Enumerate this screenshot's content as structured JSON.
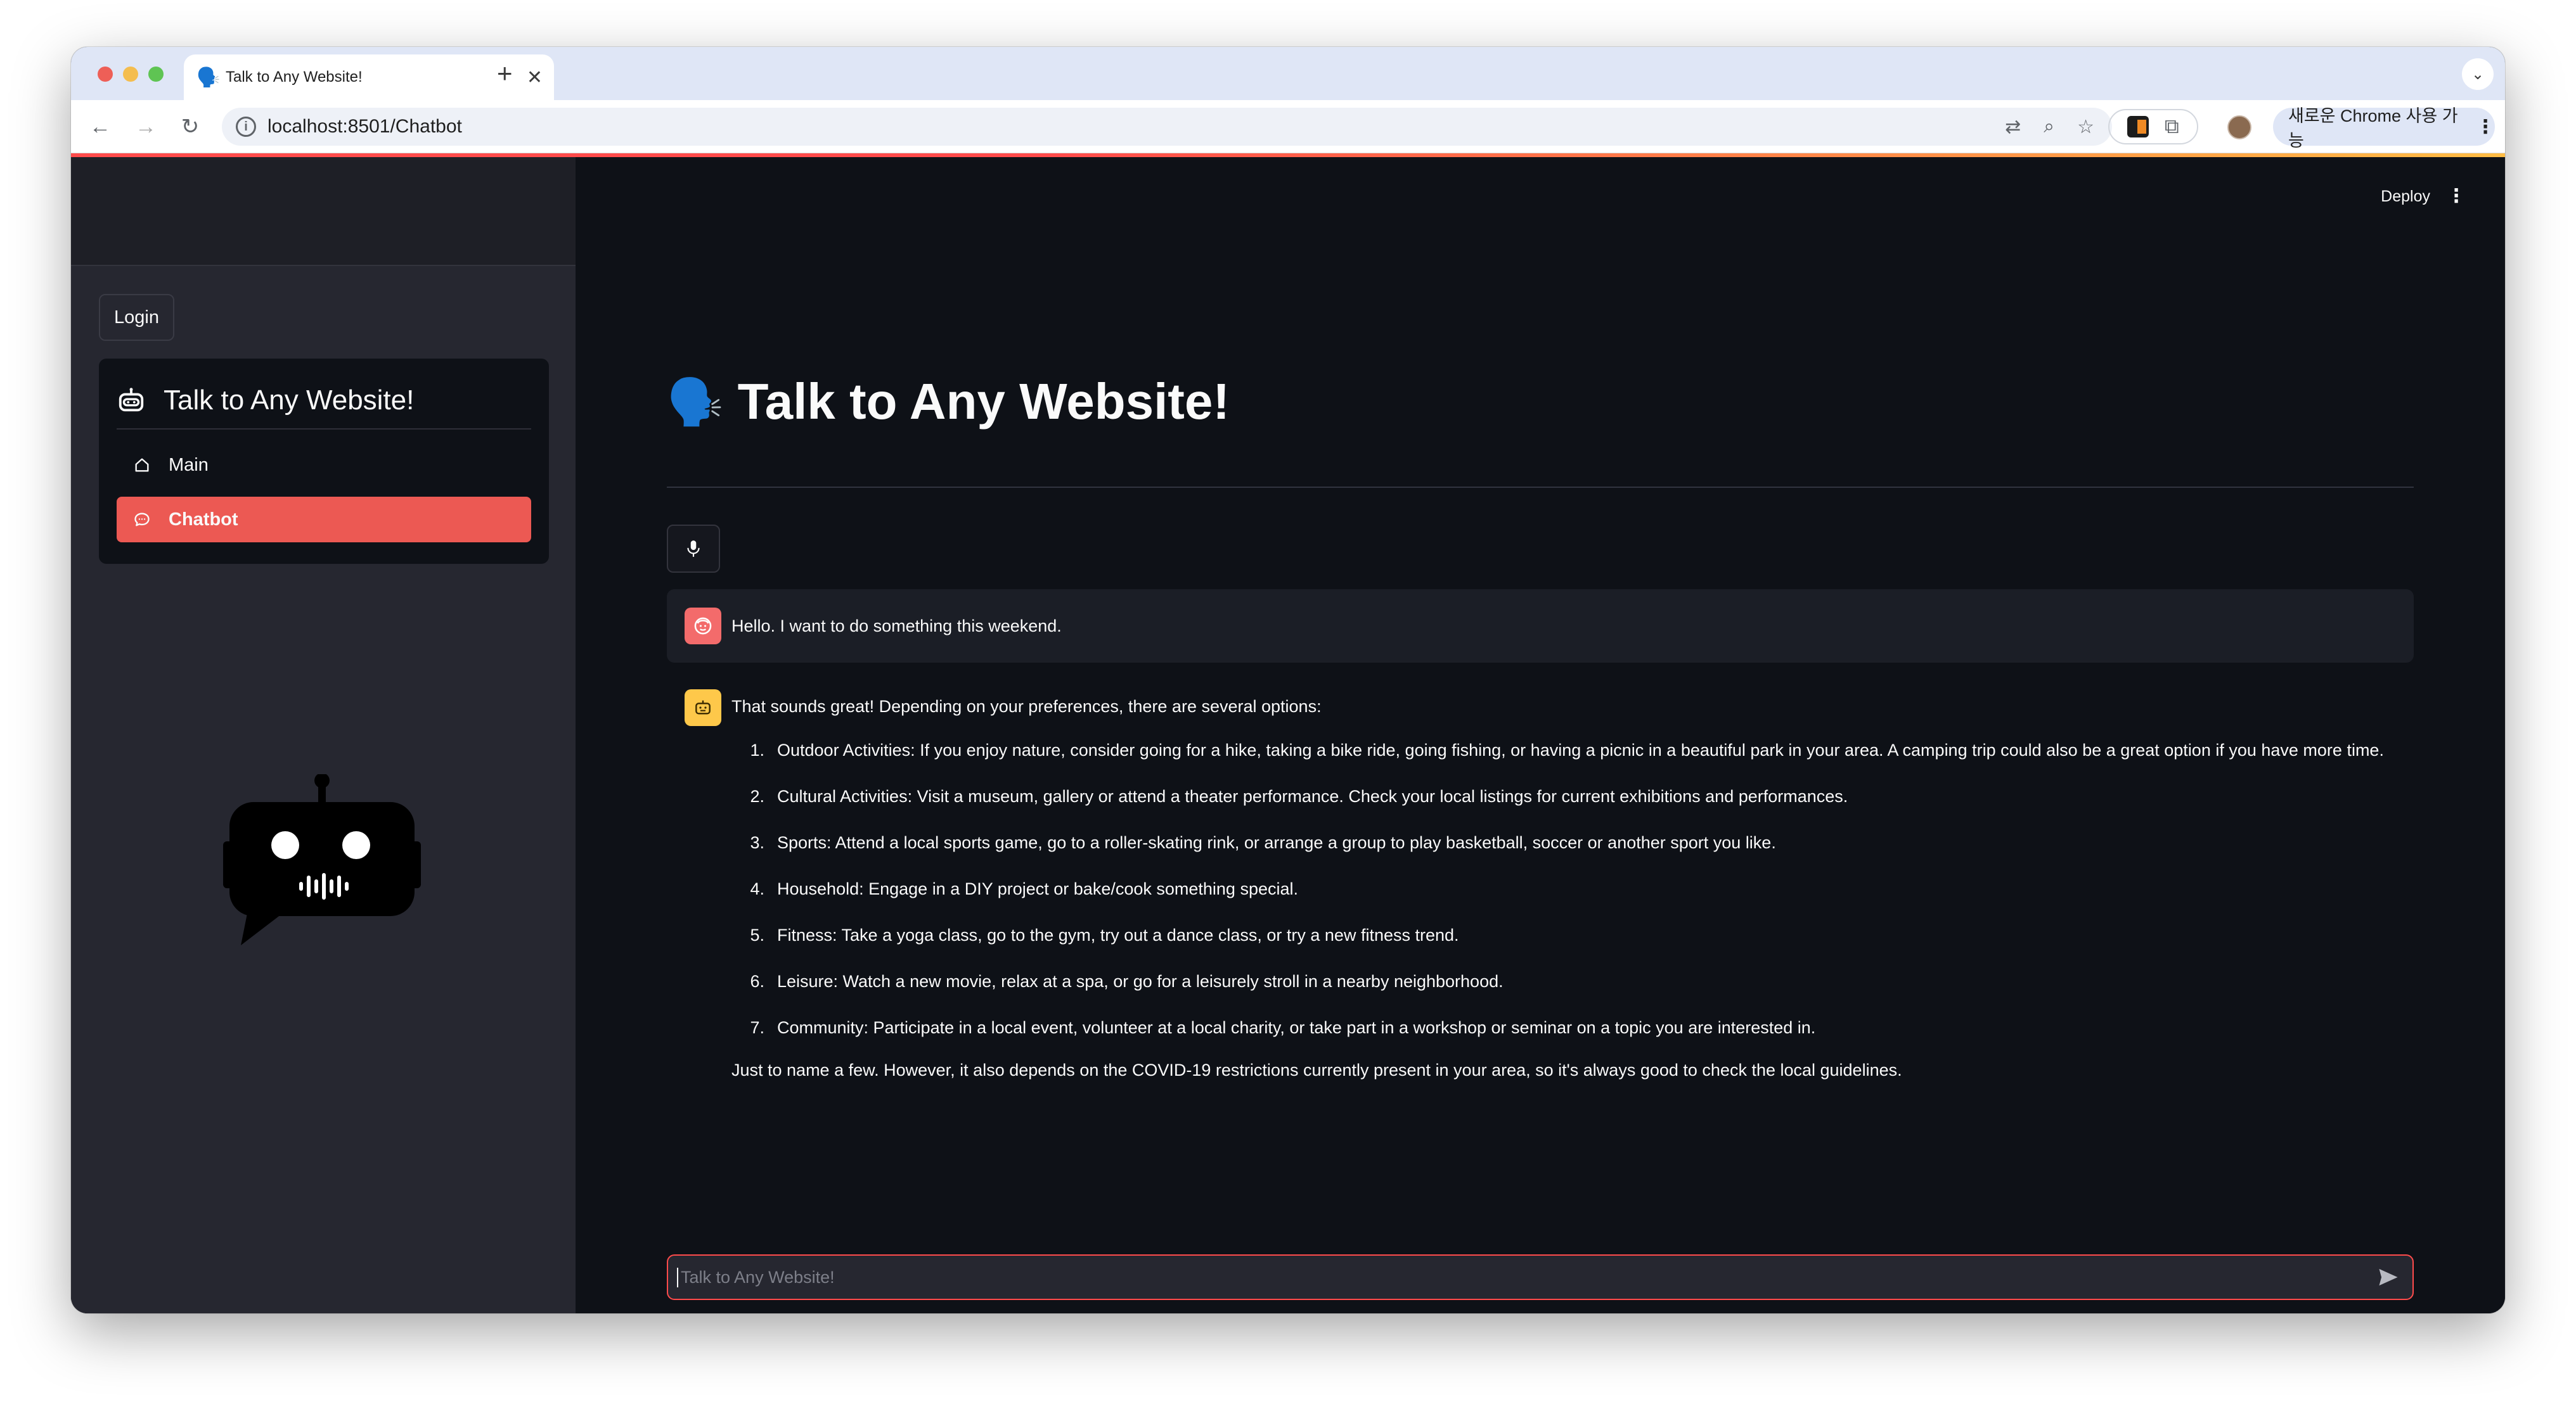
{
  "browser": {
    "tab_title": "Talk to Any Website!",
    "tab_favicon": "🗣️",
    "new_tab_label": "+",
    "url": "localhost:8501/Chatbot",
    "chrome_button_label": "새로운 Chrome 사용 가능",
    "close_glyph": "✕"
  },
  "app": {
    "deploy_label": "Deploy",
    "login_label": "Login",
    "menu": {
      "title": "Talk to Any Website!",
      "items": [
        {
          "label": "Main",
          "icon": "house-icon",
          "active": false
        },
        {
          "label": "Chatbot",
          "icon": "chat-icon",
          "active": true
        }
      ]
    },
    "page_title": "Talk to Any Website!",
    "page_title_icon": "🗣️",
    "chat_input_placeholder": "Talk to Any Website!",
    "accent_color": "#ff4b4b",
    "active_item_color": "#ec5953"
  },
  "messages": {
    "user": "Hello. I want to do something this weekend.",
    "assistant": {
      "intro": "That sounds great! Depending on your preferences, there are several options:",
      "items": [
        {
          "num": "1.",
          "text": "Outdoor Activities: If you enjoy nature, consider going for a hike, taking a bike ride, going fishing, or having a picnic in a beautiful park in your area. A camping trip could also be a great option if you have more time."
        },
        {
          "num": "2.",
          "text": "Cultural Activities: Visit a museum, gallery or attend a theater performance. Check your local listings for current exhibitions and performances."
        },
        {
          "num": "3.",
          "text": "Sports: Attend a local sports game, go to a roller-skating rink, or arrange a group to play basketball, soccer or another sport you like."
        },
        {
          "num": "4.",
          "text": "Household: Engage in a DIY project or bake/cook something special."
        },
        {
          "num": "5.",
          "text": "Fitness: Take a yoga class, go to the gym, try out a dance class, or try a new fitness trend."
        },
        {
          "num": "6.",
          "text": "Leisure: Watch a new movie, relax at a spa, or go for a leisurely stroll in a nearby neighborhood."
        },
        {
          "num": "7.",
          "text": "Community: Participate in a local event, volunteer at a local charity, or take part in a workshop or seminar on a topic you are interested in."
        }
      ],
      "outro": "Just to name a few. However, it also depends on the COVID-19 restrictions currently present in your area, so it's always good to check the local guidelines."
    }
  }
}
